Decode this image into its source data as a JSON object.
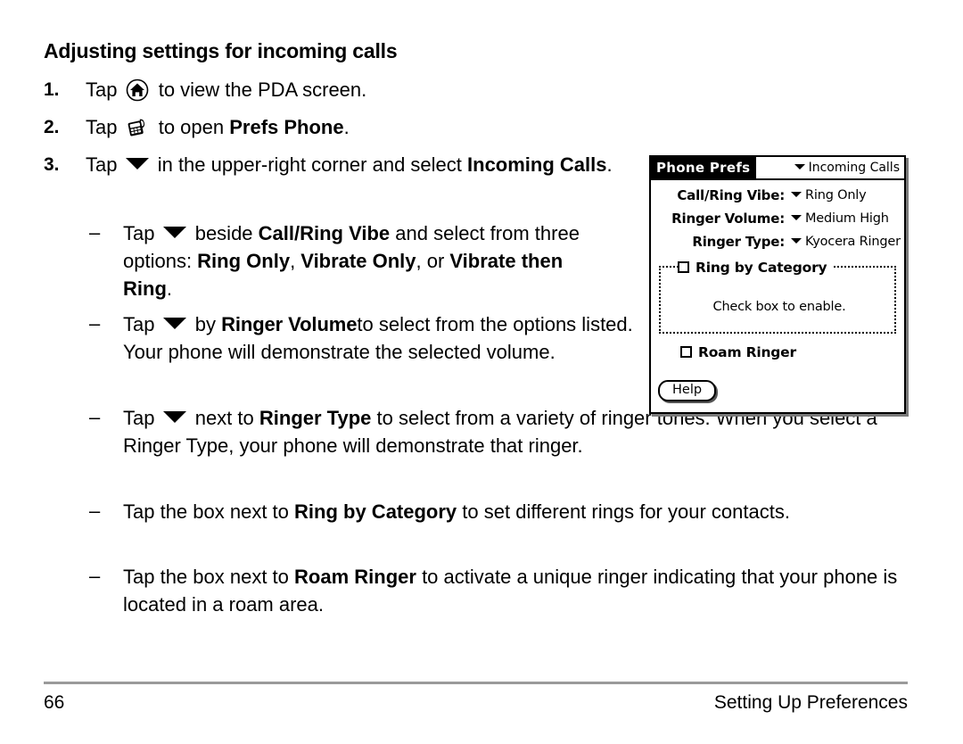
{
  "document": {
    "heading": "Adjusting settings for incoming calls",
    "steps": [
      {
        "number": "1.",
        "pre": "Tap ",
        "icon": "home-icon",
        "post": " to view the PDA screen."
      },
      {
        "number": "2.",
        "pre": "Tap ",
        "icon": "prefs-phone-icon",
        "post_a": " to open ",
        "bold": "Prefs Phone",
        "post_b": "."
      },
      {
        "number": "3.",
        "pre": "Tap ",
        "icon": "down-caret-icon",
        "post_a": " in the upper-right corner and select ",
        "bold": "Incoming Calls",
        "post_b": "."
      }
    ],
    "bullets": [
      {
        "dash": "–",
        "t1": "Tap ",
        "t2": " beside ",
        "b1": "Call/Ring Vibe",
        "t3": " and select from three options: ",
        "b2": "Ring Only",
        "t4": ", ",
        "b3": "Vibrate Only",
        "t5": ", or ",
        "b4": "Vibrate then Ring",
        "t6": "."
      },
      {
        "dash": "–",
        "t1": "Tap ",
        "t2": " by ",
        "b1": "Ringer Volume",
        "t3": "to select from the options listed. Your phone will demonstrate the selected volume."
      },
      {
        "dash": "–",
        "t1": "Tap ",
        "t2": " next to ",
        "b1": "Ringer Type",
        "t3": " to select from a variety of ringer tones. When you select a Ringer Type, your phone will demonstrate that ringer."
      },
      {
        "dash": "–",
        "t1": "Tap the box next to ",
        "b1": "Ring by Category",
        "t3": " to set different rings for your contacts."
      },
      {
        "dash": "–",
        "t1": "Tap the box next to ",
        "b1": "Roam Ringer",
        "t3": " to activate a unique ringer indicating that your phone is located in a roam area."
      }
    ],
    "footer": {
      "page_number": "66",
      "section": "Setting Up Preferences"
    }
  },
  "pda_screenshot": {
    "title": "Phone Prefs",
    "category": "Incoming Calls",
    "rows": [
      {
        "label": "Call/Ring Vibe:",
        "value": "Ring Only"
      },
      {
        "label": "Ringer Volume:",
        "value": "Medium High"
      },
      {
        "label": "Ringer Type:",
        "value": "Kyocera Ringer"
      }
    ],
    "ring_by_category": {
      "label": "Ring by Category",
      "checked": false,
      "note": "Check box to enable."
    },
    "roam_ringer": {
      "label": "Roam Ringer",
      "checked": false
    },
    "help_button": "Help"
  }
}
